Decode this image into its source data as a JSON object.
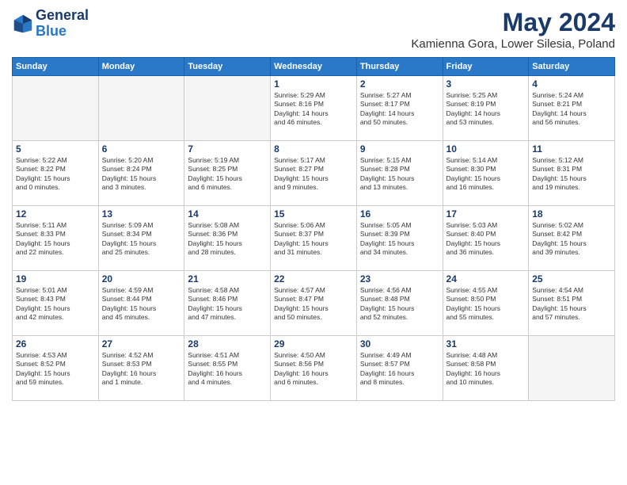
{
  "header": {
    "logo_line1": "General",
    "logo_line2": "Blue",
    "month": "May 2024",
    "location": "Kamienna Gora, Lower Silesia, Poland"
  },
  "days_of_week": [
    "Sunday",
    "Monday",
    "Tuesday",
    "Wednesday",
    "Thursday",
    "Friday",
    "Saturday"
  ],
  "weeks": [
    [
      {
        "day": "",
        "info": ""
      },
      {
        "day": "",
        "info": ""
      },
      {
        "day": "",
        "info": ""
      },
      {
        "day": "1",
        "info": "Sunrise: 5:29 AM\nSunset: 8:16 PM\nDaylight: 14 hours\nand 46 minutes."
      },
      {
        "day": "2",
        "info": "Sunrise: 5:27 AM\nSunset: 8:17 PM\nDaylight: 14 hours\nand 50 minutes."
      },
      {
        "day": "3",
        "info": "Sunrise: 5:25 AM\nSunset: 8:19 PM\nDaylight: 14 hours\nand 53 minutes."
      },
      {
        "day": "4",
        "info": "Sunrise: 5:24 AM\nSunset: 8:21 PM\nDaylight: 14 hours\nand 56 minutes."
      }
    ],
    [
      {
        "day": "5",
        "info": "Sunrise: 5:22 AM\nSunset: 8:22 PM\nDaylight: 15 hours\nand 0 minutes."
      },
      {
        "day": "6",
        "info": "Sunrise: 5:20 AM\nSunset: 8:24 PM\nDaylight: 15 hours\nand 3 minutes."
      },
      {
        "day": "7",
        "info": "Sunrise: 5:19 AM\nSunset: 8:25 PM\nDaylight: 15 hours\nand 6 minutes."
      },
      {
        "day": "8",
        "info": "Sunrise: 5:17 AM\nSunset: 8:27 PM\nDaylight: 15 hours\nand 9 minutes."
      },
      {
        "day": "9",
        "info": "Sunrise: 5:15 AM\nSunset: 8:28 PM\nDaylight: 15 hours\nand 13 minutes."
      },
      {
        "day": "10",
        "info": "Sunrise: 5:14 AM\nSunset: 8:30 PM\nDaylight: 15 hours\nand 16 minutes."
      },
      {
        "day": "11",
        "info": "Sunrise: 5:12 AM\nSunset: 8:31 PM\nDaylight: 15 hours\nand 19 minutes."
      }
    ],
    [
      {
        "day": "12",
        "info": "Sunrise: 5:11 AM\nSunset: 8:33 PM\nDaylight: 15 hours\nand 22 minutes."
      },
      {
        "day": "13",
        "info": "Sunrise: 5:09 AM\nSunset: 8:34 PM\nDaylight: 15 hours\nand 25 minutes."
      },
      {
        "day": "14",
        "info": "Sunrise: 5:08 AM\nSunset: 8:36 PM\nDaylight: 15 hours\nand 28 minutes."
      },
      {
        "day": "15",
        "info": "Sunrise: 5:06 AM\nSunset: 8:37 PM\nDaylight: 15 hours\nand 31 minutes."
      },
      {
        "day": "16",
        "info": "Sunrise: 5:05 AM\nSunset: 8:39 PM\nDaylight: 15 hours\nand 34 minutes."
      },
      {
        "day": "17",
        "info": "Sunrise: 5:03 AM\nSunset: 8:40 PM\nDaylight: 15 hours\nand 36 minutes."
      },
      {
        "day": "18",
        "info": "Sunrise: 5:02 AM\nSunset: 8:42 PM\nDaylight: 15 hours\nand 39 minutes."
      }
    ],
    [
      {
        "day": "19",
        "info": "Sunrise: 5:01 AM\nSunset: 8:43 PM\nDaylight: 15 hours\nand 42 minutes."
      },
      {
        "day": "20",
        "info": "Sunrise: 4:59 AM\nSunset: 8:44 PM\nDaylight: 15 hours\nand 45 minutes."
      },
      {
        "day": "21",
        "info": "Sunrise: 4:58 AM\nSunset: 8:46 PM\nDaylight: 15 hours\nand 47 minutes."
      },
      {
        "day": "22",
        "info": "Sunrise: 4:57 AM\nSunset: 8:47 PM\nDaylight: 15 hours\nand 50 minutes."
      },
      {
        "day": "23",
        "info": "Sunrise: 4:56 AM\nSunset: 8:48 PM\nDaylight: 15 hours\nand 52 minutes."
      },
      {
        "day": "24",
        "info": "Sunrise: 4:55 AM\nSunset: 8:50 PM\nDaylight: 15 hours\nand 55 minutes."
      },
      {
        "day": "25",
        "info": "Sunrise: 4:54 AM\nSunset: 8:51 PM\nDaylight: 15 hours\nand 57 minutes."
      }
    ],
    [
      {
        "day": "26",
        "info": "Sunrise: 4:53 AM\nSunset: 8:52 PM\nDaylight: 15 hours\nand 59 minutes."
      },
      {
        "day": "27",
        "info": "Sunrise: 4:52 AM\nSunset: 8:53 PM\nDaylight: 16 hours\nand 1 minute."
      },
      {
        "day": "28",
        "info": "Sunrise: 4:51 AM\nSunset: 8:55 PM\nDaylight: 16 hours\nand 4 minutes."
      },
      {
        "day": "29",
        "info": "Sunrise: 4:50 AM\nSunset: 8:56 PM\nDaylight: 16 hours\nand 6 minutes."
      },
      {
        "day": "30",
        "info": "Sunrise: 4:49 AM\nSunset: 8:57 PM\nDaylight: 16 hours\nand 8 minutes."
      },
      {
        "day": "31",
        "info": "Sunrise: 4:48 AM\nSunset: 8:58 PM\nDaylight: 16 hours\nand 10 minutes."
      },
      {
        "day": "",
        "info": ""
      }
    ]
  ]
}
